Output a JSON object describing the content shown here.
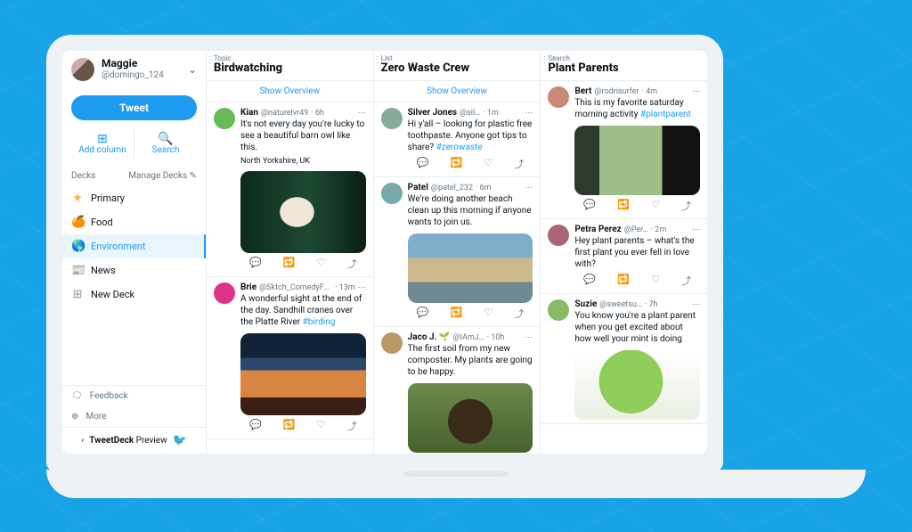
{
  "sidebar": {
    "profile": {
      "name": "Maggie",
      "handle": "@domingo_124"
    },
    "tweet_btn": "Tweet",
    "actions": {
      "add_column": "Add column",
      "search": "Search"
    },
    "decks_label": "Decks",
    "manage_label": "Manage Decks",
    "decks": [
      {
        "icon": "★",
        "label": "Primary",
        "color": "#f5b74d"
      },
      {
        "icon": "🍊",
        "label": "Food",
        "color": "#f28c2a"
      },
      {
        "icon": "🌎",
        "label": "Environment",
        "color": "#1d9bf0",
        "active": true
      },
      {
        "icon": "📰",
        "label": "News",
        "color": "#8899a6"
      },
      {
        "icon": "⊞",
        "label": "New Deck",
        "color": "#8899a6"
      }
    ],
    "footer": {
      "feedback": "Feedback",
      "more": "More"
    },
    "preview": {
      "bold": "TweetDeck",
      "rest": "Preview"
    }
  },
  "columns": [
    {
      "kind": "Topic",
      "title": "Birdwatching",
      "overview": "Show Overview",
      "tweets": [
        {
          "av": "av1",
          "name": "Kian",
          "handle": "@naturelvr49",
          "time": "6h",
          "text": "It's not every day you're lucky to see a beautiful barn owl like this.",
          "loc": "North Yorkshire, UK",
          "media": "m-owl"
        },
        {
          "av": "av2",
          "name": "Brie",
          "handle": "@Sktch_ComedyFan",
          "time": "13m",
          "text": "A wonderful sight at the end of the day. Sandhill cranes over the Platte River",
          "hashtag": "#birding",
          "media": "m-sunset"
        }
      ]
    },
    {
      "kind": "List",
      "title": "Zero Waste Crew",
      "overview": "Show Overview",
      "tweets": [
        {
          "av": "av3",
          "name": "Silver Jones",
          "handle": "@sil…",
          "time": "1m",
          "text": "Hi y'all – looking for plastic free toothpaste. Anyone got tips to share?",
          "hashtag": "#zerowaste",
          "actions_only": false,
          "show_actions": true
        },
        {
          "av": "av4",
          "name": "Patel",
          "handle": "@patel_232",
          "time": "6m",
          "text": "We're doing another beach clean up this morning if anyone wants to join us.",
          "media": "m-beach",
          "media_size": "sm"
        },
        {
          "av": "av5",
          "name": "Jaco J. 🌱",
          "handle": "@IAmJ…",
          "time": "10h",
          "text": "The first soil from my new composter. My plants are going to be happy.",
          "media": "m-compost",
          "media_size": "sm",
          "cut": true
        }
      ]
    },
    {
      "kind": "Search",
      "title": "Plant Parents",
      "overview": "",
      "tweets": [
        {
          "av": "av6",
          "name": "Bert",
          "handle": "@rodrisurfer",
          "time": "4m",
          "text": "This is my favorite saturday morning activity",
          "hashtag": "#plantparent",
          "media": "m-window",
          "media_size": "sm"
        },
        {
          "av": "av7",
          "name": "Petra Perez",
          "handle": "@Per…",
          "time": "2m",
          "text": "Hey plant parents – what's the first plant you ever fell in love with?",
          "show_actions": false
        },
        {
          "av": "av8",
          "name": "Suzie",
          "handle": "@sweetsu…",
          "time": "7h",
          "text": "You know you're a plant parent when you get excited about how well your mint is doing",
          "media": "m-mint",
          "media_size": "sm",
          "cut": true
        }
      ]
    }
  ],
  "icons": {
    "reply": "💬",
    "retweet": "🔁",
    "like": "♡",
    "share": "⤴"
  }
}
